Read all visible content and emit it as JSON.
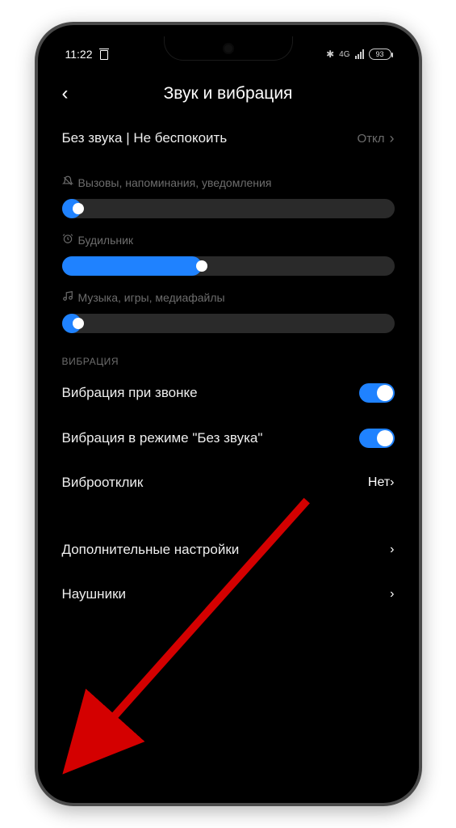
{
  "status": {
    "time": "11:22",
    "network": "4G",
    "battery": "93"
  },
  "header": {
    "title": "Звук и вибрация"
  },
  "dnd": {
    "label": "Без звука | Не беспокоить",
    "value": "Откл"
  },
  "sliders": {
    "ringer": {
      "caption": "Вызовы, напоминания, уведомления",
      "pct": 5
    },
    "alarm": {
      "caption": "Будильник",
      "pct": 42
    },
    "media": {
      "caption": "Музыка, игры, медиафайлы",
      "pct": 5
    }
  },
  "sections": {
    "vibration": "ВИБРАЦИЯ"
  },
  "toggles": {
    "vibrate_on_call": {
      "label": "Вибрация при звонке",
      "on": true
    },
    "vibrate_silent": {
      "label": "Вибрация в режиме \"Без звука\"",
      "on": true
    }
  },
  "haptic": {
    "label": "Виброотклик",
    "value": "Нет"
  },
  "extra": {
    "additional": "Дополнительные настройки",
    "headphones": "Наушники"
  },
  "colors": {
    "accent": "#1f82ff"
  }
}
